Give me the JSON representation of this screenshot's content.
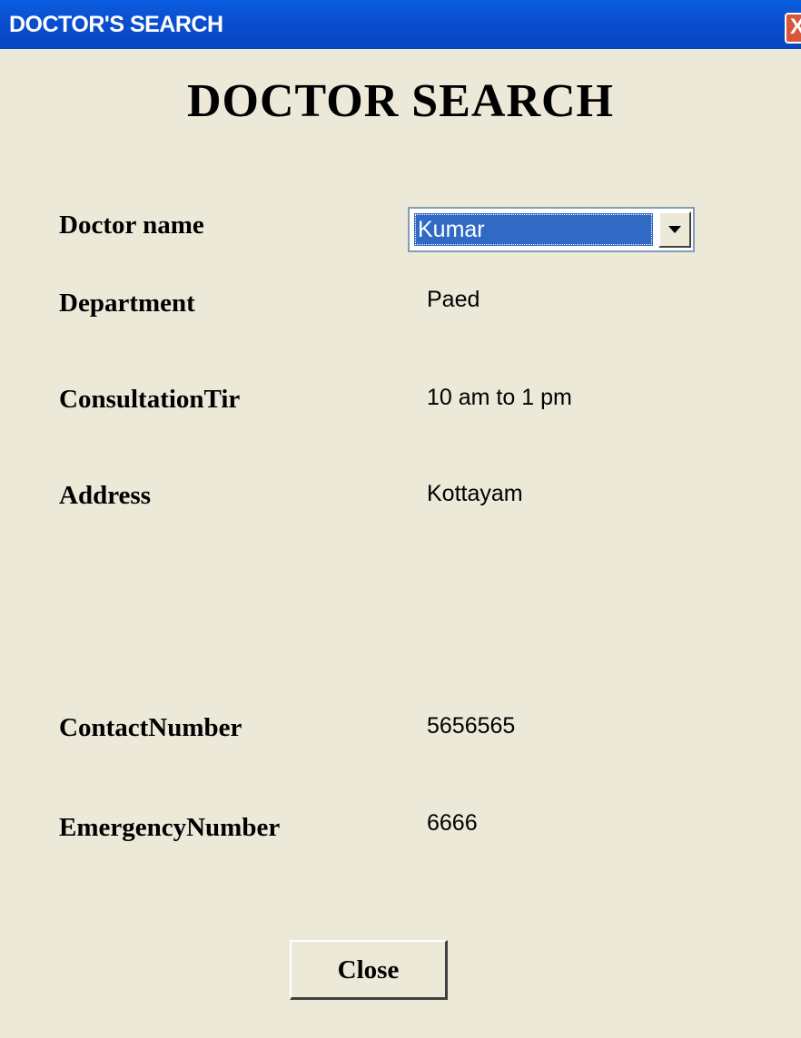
{
  "window": {
    "title": "DOCTOR'S SEARCH",
    "close_glyph": "X"
  },
  "form": {
    "heading": "DOCTOR SEARCH",
    "fields": {
      "doctor_name": {
        "label": "Doctor  name",
        "value": "Kumar"
      },
      "department": {
        "label": "Department",
        "value": "Paed"
      },
      "consultation_time": {
        "label": "ConsultationTir",
        "value": "10 am to 1 pm"
      },
      "address": {
        "label": "Address",
        "value": "Kottayam"
      },
      "contact_number": {
        "label": "ContactNumber",
        "value": "5656565"
      },
      "emergency_number": {
        "label": "EmergencyNumber",
        "value": "6666"
      }
    },
    "close_button_label": "Close"
  },
  "icons": {
    "window_close": "close-icon",
    "combo_dropdown": "chevron-down-icon"
  },
  "colors": {
    "titlebar": "#0a4fd0",
    "window_background": "#ece9d8",
    "selection": "#316ac5",
    "close_button": "#d8563b"
  }
}
